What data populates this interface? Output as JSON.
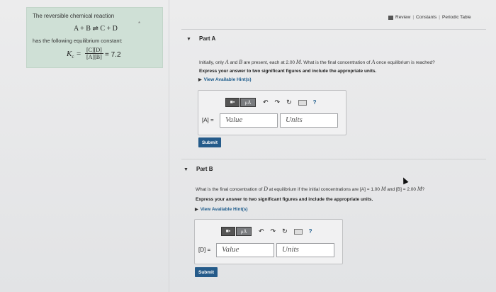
{
  "header": {
    "review_label": "Review",
    "constants_label": "Constants",
    "periodic_label": "Periodic Table"
  },
  "problem": {
    "intro": "The reversible chemical reaction",
    "reaction": "A + B ⇌ C + D",
    "constant_intro": "has the following equilibrium constant:",
    "kc_symbol": "K",
    "kc_sub": "c",
    "kc_num": "[C][D]",
    "kc_den": "[A][B]",
    "kc_value": "= 7.2"
  },
  "part_a": {
    "title": "Part A",
    "question_1": "Initially, only",
    "sym_a": "A",
    "question_2": "and",
    "sym_b": "B",
    "question_3": "are present, each at 2.00",
    "unit": "M",
    "question_4": ". What is the final concentration of",
    "question_5": "once equilibrium is reached?",
    "instruction": "Express your answer to two significant figures and include the appropriate units.",
    "hint": "View Available Hint(s)",
    "var_label": "[A] =",
    "value_placeholder": "Value",
    "units_placeholder": "Units",
    "submit": "Submit"
  },
  "part_b": {
    "title": "Part B",
    "question_1": "What is the final concentration of",
    "sym_d": "D",
    "question_2": "at equilibrium if the initial concentrations are",
    "conc_a": "[A] = 1.00",
    "unit": "M",
    "question_3": "and",
    "conc_b": "[B] = 2.00",
    "question_4": "?",
    "instruction": "Express your answer to two significant figures and include the appropriate units.",
    "hint": "View Available Hint(s)",
    "var_label": "[D] =",
    "value_placeholder": "Value",
    "units_placeholder": "Units",
    "submit": "Submit"
  },
  "toolbar": {
    "templates_glyph": "■▪",
    "mu_glyph": "μÅ",
    "undo_glyph": "↶",
    "redo_glyph": "↷",
    "reset_glyph": "↻",
    "help_glyph": "?"
  }
}
